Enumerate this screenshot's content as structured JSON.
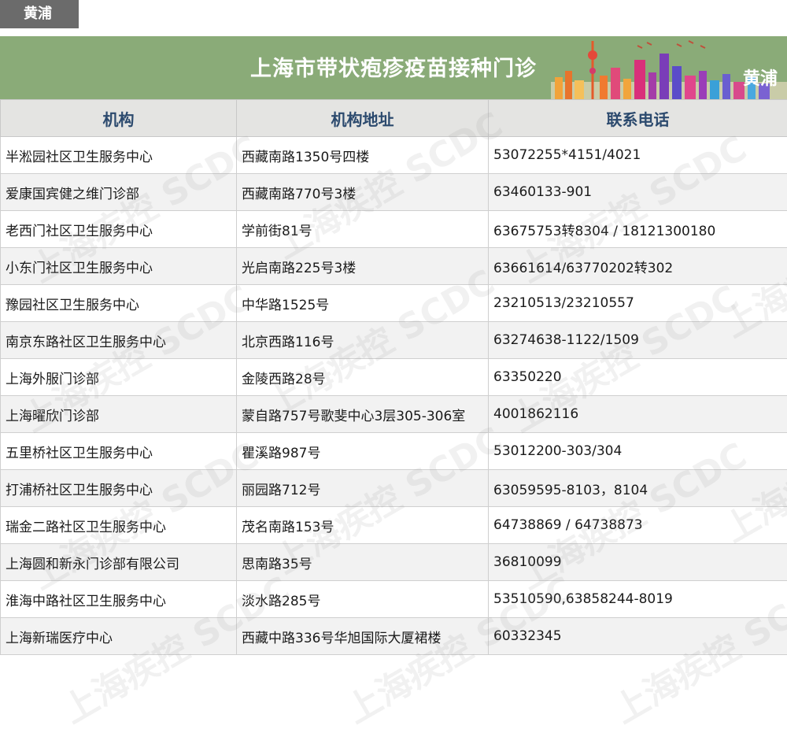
{
  "tag": "黄浦",
  "banner": {
    "title": "上海市带状疱疹疫苗接种门诊",
    "district": "黄浦"
  },
  "watermark": "上海疾控 SCDC",
  "columns": [
    "机构",
    "机构地址",
    "联系电话"
  ],
  "rows": [
    [
      "半淞园社区卫生服务中心",
      "西藏南路1350号四楼",
      "53072255*4151/4021"
    ],
    [
      "爱康国宾健之维门诊部",
      "西藏南路770号3楼",
      "63460133-901"
    ],
    [
      "老西门社区卫生服务中心",
      "学前街81号",
      "63675753转8304 / 18121300180"
    ],
    [
      "小东门社区卫生服务中心",
      "光启南路225号3楼",
      "63661614/63770202转302"
    ],
    [
      "豫园社区卫生服务中心",
      "中华路1525号",
      "23210513/23210557"
    ],
    [
      "南京东路社区卫生服务中心",
      "北京西路116号",
      "63274638-1122/1509"
    ],
    [
      "上海外服门诊部",
      "金陵西路28号",
      "63350220"
    ],
    [
      "上海曜欣门诊部",
      "蒙自路757号歌斐中心3层305-306室",
      "4001862116"
    ],
    [
      "五里桥社区卫生服务中心",
      "瞿溪路987号",
      "53012200-303/304"
    ],
    [
      "打浦桥社区卫生服务中心",
      "丽园路712号",
      "63059595-8103，8104"
    ],
    [
      "瑞金二路社区卫生服务中心",
      "茂名南路153号",
      "64738869 / 64738873"
    ],
    [
      "上海圆和新永门诊部有限公司",
      "思南路35号",
      "36810099"
    ],
    [
      "淮海中路社区卫生服务中心",
      "淡水路285号",
      "53510590,63858244-8019"
    ],
    [
      "上海新瑞医疗中心",
      "西藏中路336号华旭国际大厦裙楼",
      "60332345"
    ]
  ]
}
